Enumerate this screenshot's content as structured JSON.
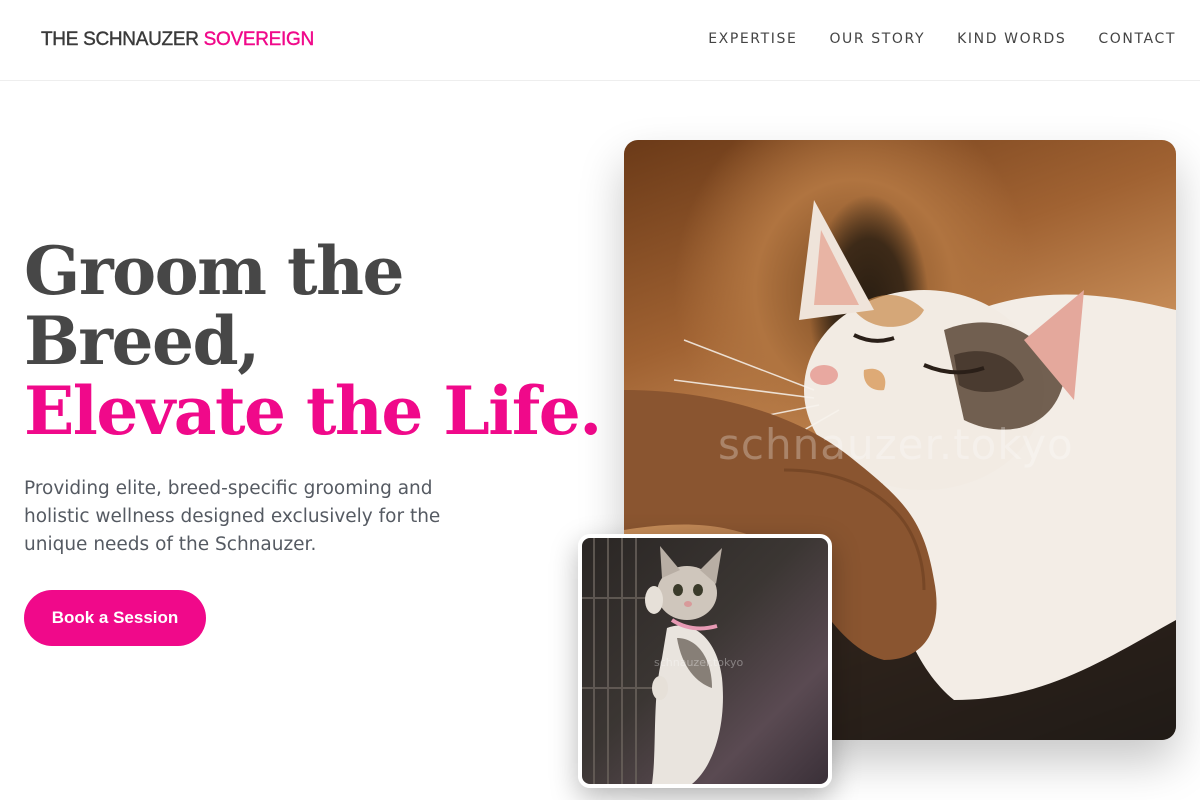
{
  "brand": {
    "name_main": "THE SCHNAUZER",
    "name_accent": "SOVEREIGN"
  },
  "nav": [
    "EXPERTISE",
    "OUR STORY",
    "KIND WORDS",
    "CONTACT"
  ],
  "hero": {
    "headline_line1": "Groom the",
    "headline_line2": "Breed,",
    "headline_line3": "Elevate the Life.",
    "subtext": "Providing elite, breed-specific grooming and holistic wellness designed exclusively for the unique needs of the Schnauzer.",
    "cta_label": "Book a Session"
  },
  "images": {
    "main_watermark": "schnauzer.tokyo",
    "inset_watermark": "schnauzer.tokyo"
  },
  "colors": {
    "accent": "#f0098a",
    "heading": "#474747",
    "body_text": "#555a62"
  }
}
